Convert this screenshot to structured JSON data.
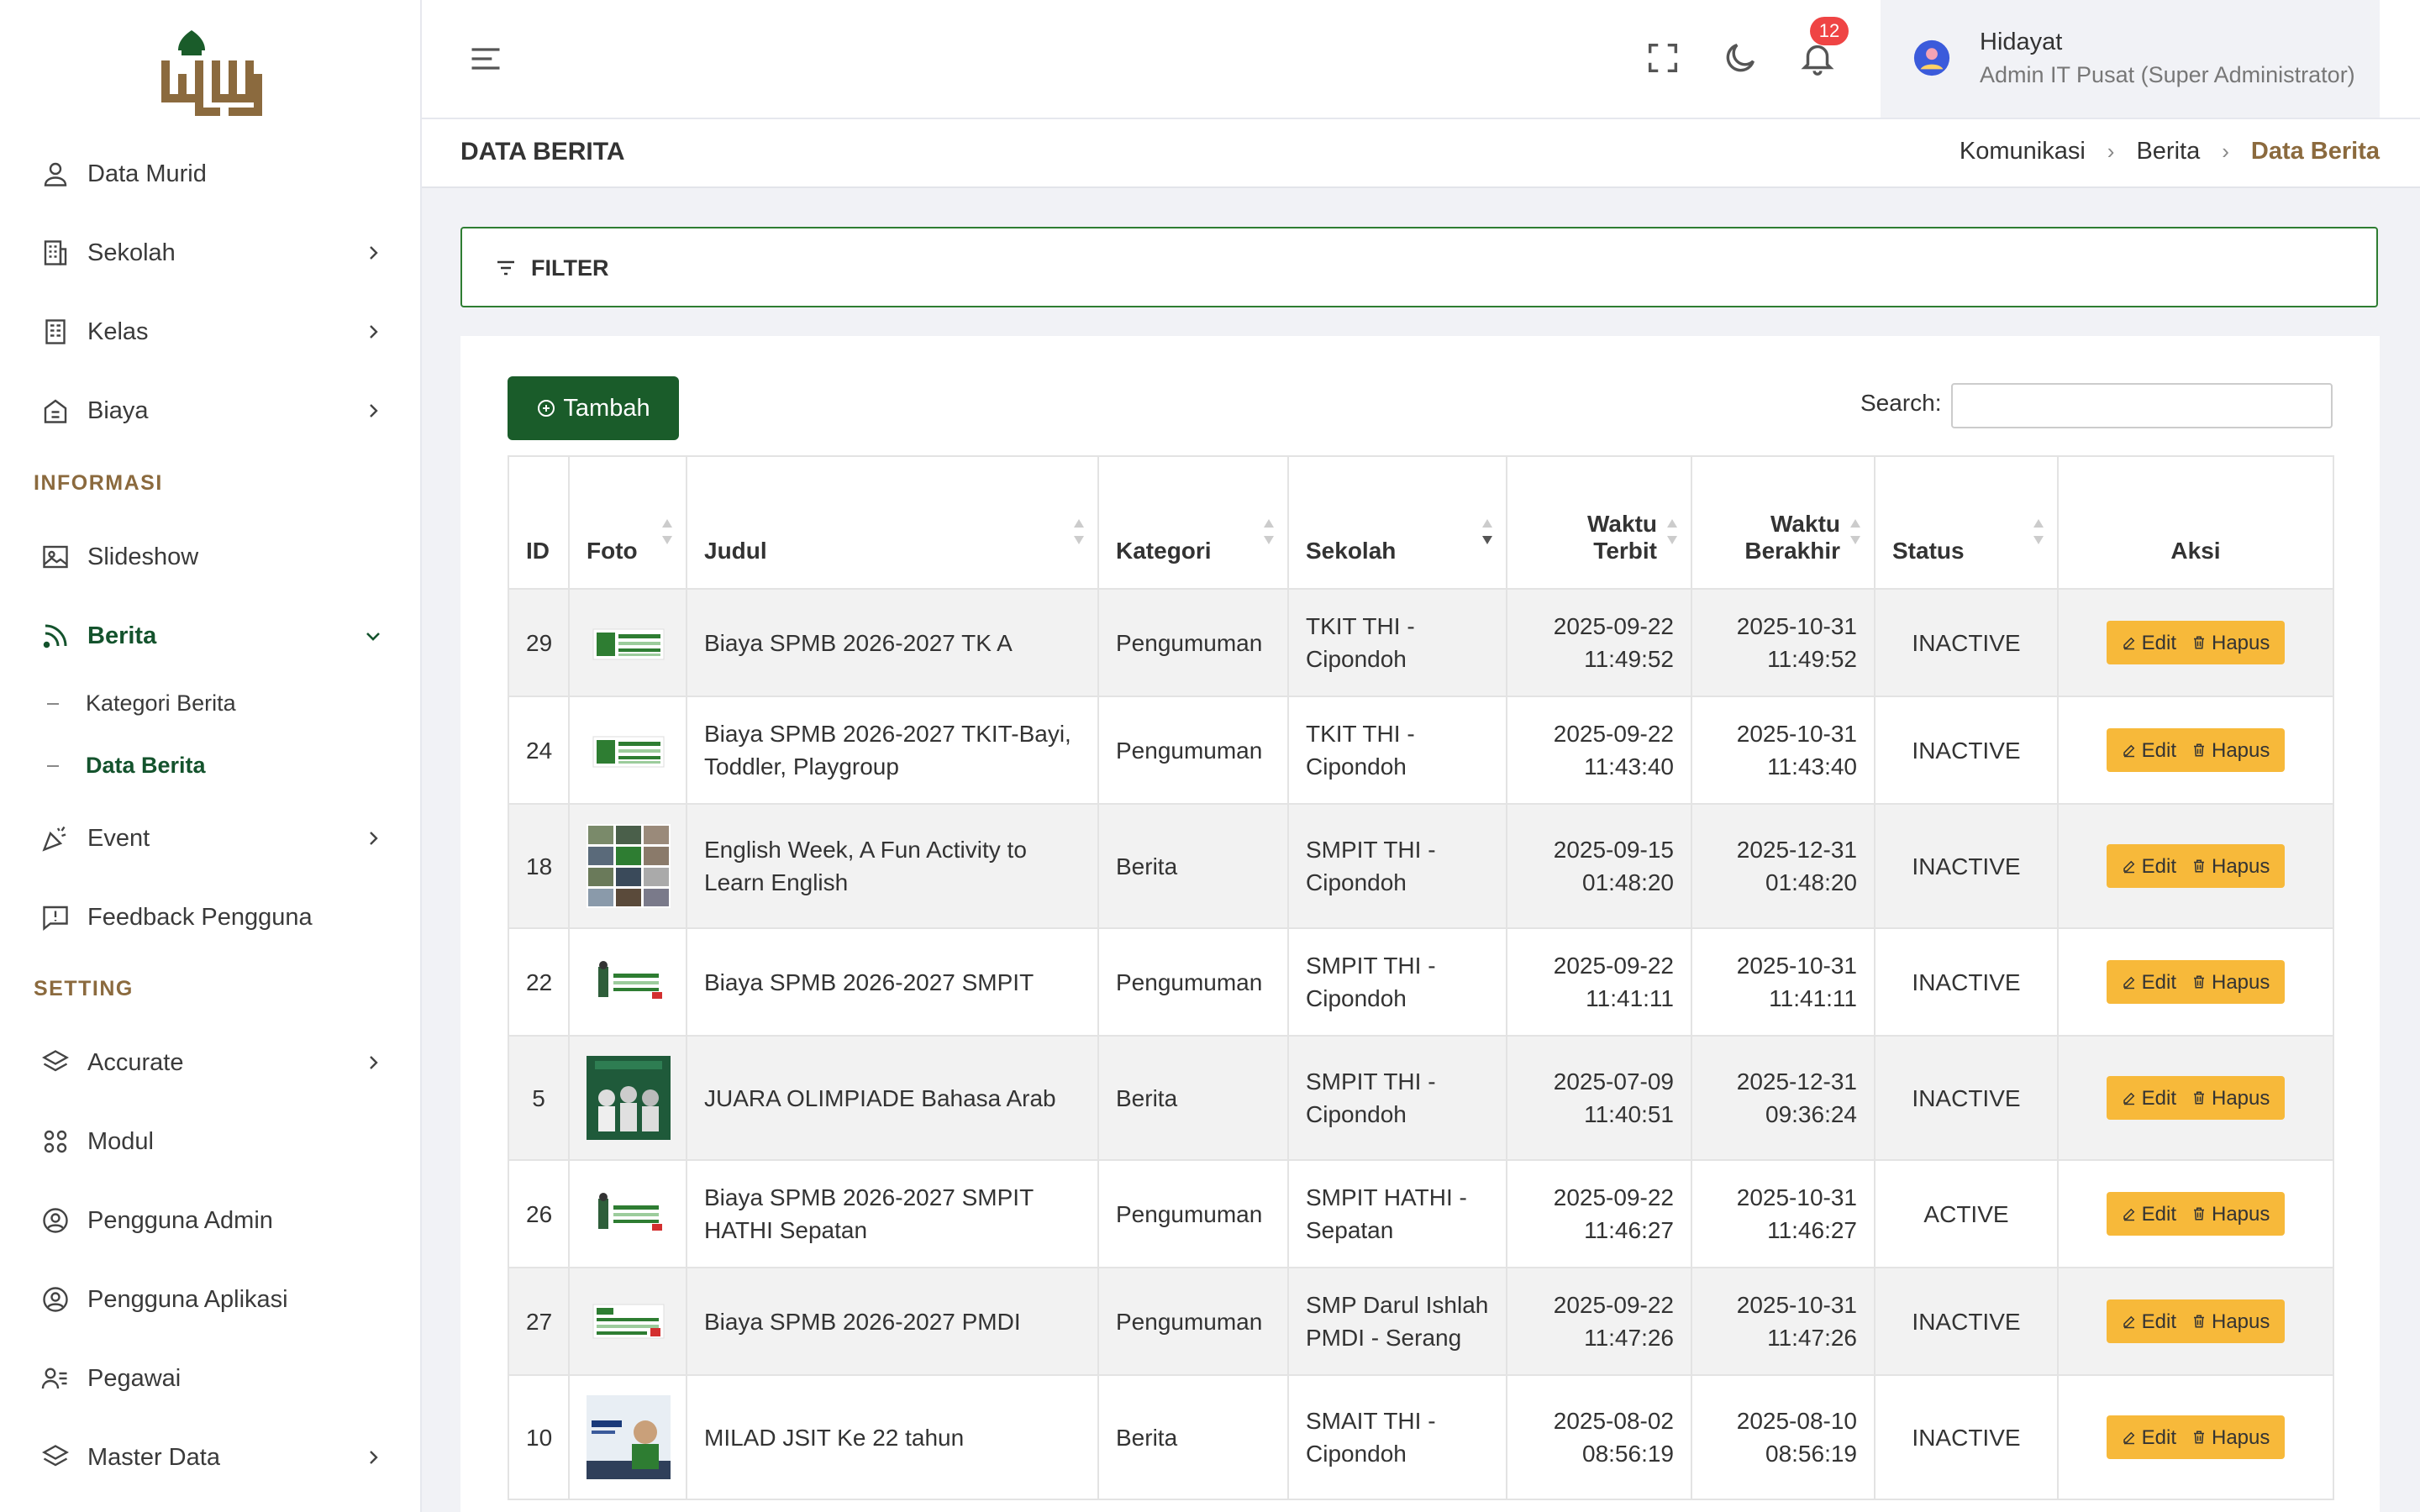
{
  "sidebar": {
    "items_top": [
      {
        "label": "Data Murid",
        "icon": "user-icon",
        "has_children": false
      },
      {
        "label": "Sekolah",
        "icon": "building-icon",
        "has_children": true
      },
      {
        "label": "Kelas",
        "icon": "classroom-icon",
        "has_children": true
      },
      {
        "label": "Biaya",
        "icon": "receipt-icon",
        "has_children": true
      }
    ],
    "section_informasi": "INFORMASI",
    "items_info": [
      {
        "label": "Slideshow",
        "icon": "image-icon",
        "has_children": false
      },
      {
        "label": "Berita",
        "icon": "rss-icon",
        "has_children": true,
        "expanded": true
      }
    ],
    "berita_sub": [
      {
        "label": "Kategori Berita",
        "active": false
      },
      {
        "label": "Data Berita",
        "active": true
      }
    ],
    "items_info2": [
      {
        "label": "Event",
        "icon": "party-icon",
        "has_children": true
      },
      {
        "label": "Feedback Pengguna",
        "icon": "feedback-icon",
        "has_children": false
      }
    ],
    "section_setting": "SETTING",
    "items_setting": [
      {
        "label": "Accurate",
        "icon": "layers-icon",
        "has_children": true
      },
      {
        "label": "Modul",
        "icon": "modules-icon",
        "has_children": false
      },
      {
        "label": "Pengguna Admin",
        "icon": "user-circle-icon",
        "has_children": false
      },
      {
        "label": "Pengguna Aplikasi",
        "icon": "user-circle-icon",
        "has_children": false
      },
      {
        "label": "Pegawai",
        "icon": "user-list-icon",
        "has_children": false
      },
      {
        "label": "Master Data",
        "icon": "layers-icon",
        "has_children": true
      }
    ]
  },
  "header": {
    "notification_count": "12",
    "user_name": "Hidayat",
    "user_role": "Admin IT Pusat (Super Administrator)"
  },
  "page": {
    "title": "DATA BERITA",
    "breadcrumb": [
      "Komunikasi",
      "Berita",
      "Data Berita"
    ]
  },
  "filter": {
    "label": "FILTER"
  },
  "toolbar": {
    "add_label": "Tambah",
    "search_label": "Search:",
    "search_value": ""
  },
  "table": {
    "headers": {
      "id": "ID",
      "foto": "Foto",
      "judul": "Judul",
      "kategori": "Kategori",
      "sekolah": "Sekolah",
      "terbit_1": "Waktu",
      "terbit_2": "Terbit",
      "berakhir_1": "Waktu",
      "berakhir_2": "Berakhir",
      "status": "Status",
      "aksi": "Aksi"
    },
    "edit_label": "Edit",
    "hapus_label": "Hapus",
    "rows": [
      {
        "id": "29",
        "judul": "Biaya SPMB 2026-2027 TK A",
        "kategori": "Pengumuman",
        "sekolah": "TKIT THI - Cipondoh",
        "terbit_date": "2025-09-22",
        "terbit_time": "11:49:52",
        "akhir_date": "2025-10-31",
        "akhir_time": "11:49:52",
        "status": "INACTIVE",
        "thumb": "fee"
      },
      {
        "id": "24",
        "judul": "Biaya SPMB 2026-2027 TKIT-Bayi, Toddler, Playgroup",
        "kategori": "Pengumuman",
        "sekolah": "TKIT THI - Cipondoh",
        "terbit_date": "2025-09-22",
        "terbit_time": "11:43:40",
        "akhir_date": "2025-10-31",
        "akhir_time": "11:43:40",
        "status": "INACTIVE",
        "thumb": "fee"
      },
      {
        "id": "18",
        "judul": "English Week, A Fun Activity to Learn English",
        "kategori": "Berita",
        "sekolah": "SMPIT THI - Cipondoh",
        "terbit_date": "2025-09-15",
        "terbit_time": "01:48:20",
        "akhir_date": "2025-12-31",
        "akhir_time": "01:48:20",
        "status": "INACTIVE",
        "thumb": "collage"
      },
      {
        "id": "22",
        "judul": "Biaya SPMB 2026-2027 SMPIT",
        "kategori": "Pengumuman",
        "sekolah": "SMPIT THI - Cipondoh",
        "terbit_date": "2025-09-22",
        "terbit_time": "11:41:11",
        "akhir_date": "2025-10-31",
        "akhir_time": "11:41:11",
        "status": "INACTIVE",
        "thumb": "fee2"
      },
      {
        "id": "5",
        "judul": "JUARA OLIMPIADE Bahasa Arab",
        "kategori": "Berita",
        "sekolah": "SMPIT THI - Cipondoh",
        "terbit_date": "2025-07-09",
        "terbit_time": "11:40:51",
        "akhir_date": "2025-12-31",
        "akhir_time": "09:36:24",
        "status": "INACTIVE",
        "thumb": "poster"
      },
      {
        "id": "26",
        "judul": "Biaya SPMB 2026-2027 SMPIT HATHI Sepatan",
        "kategori": "Pengumuman",
        "sekolah": "SMPIT HATHI - Sepatan",
        "terbit_date": "2025-09-22",
        "terbit_time": "11:46:27",
        "akhir_date": "2025-10-31",
        "akhir_time": "11:46:27",
        "status": "ACTIVE",
        "thumb": "fee2"
      },
      {
        "id": "27",
        "judul": "Biaya SPMB 2026-2027 PMDI",
        "kategori": "Pengumuman",
        "sekolah": "SMP Darul Ishlah PMDI - Serang",
        "terbit_date": "2025-09-22",
        "terbit_time": "11:47:26",
        "akhir_date": "2025-10-31",
        "akhir_time": "11:47:26",
        "status": "INACTIVE",
        "thumb": "fee3"
      },
      {
        "id": "10",
        "judul": "MILAD JSIT Ke 22 tahun",
        "kategori": "Berita",
        "sekolah": "SMAIT THI - Cipondoh",
        "terbit_date": "2025-08-02",
        "terbit_time": "08:56:19",
        "akhir_date": "2025-08-10",
        "akhir_time": "08:56:19",
        "status": "INACTIVE",
        "thumb": "milad"
      }
    ]
  },
  "colors": {
    "primary_green": "#1a5c2a",
    "accent_gold": "#8b6a3e",
    "action_yellow": "#f7b93a",
    "badge_red": "#ef4444"
  }
}
